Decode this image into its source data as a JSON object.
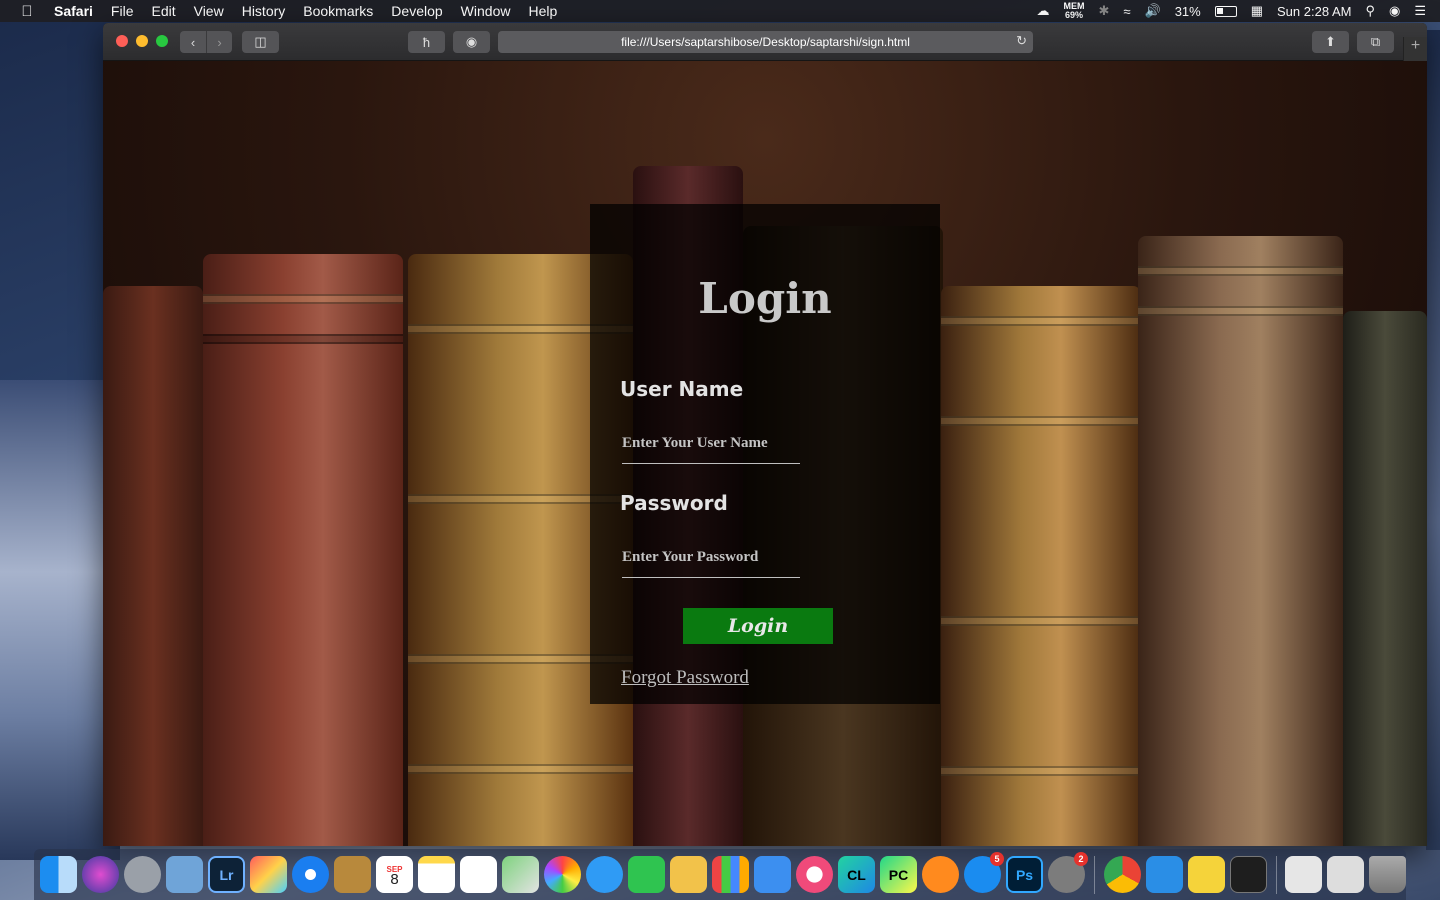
{
  "menubar": {
    "app_name": "Safari",
    "items": [
      "File",
      "Edit",
      "View",
      "History",
      "Bookmarks",
      "Develop",
      "Window",
      "Help"
    ],
    "mem_label": "MEM",
    "mem_value": "69%",
    "battery_percent": "31%",
    "battery_level": 0.31,
    "clock": "Sun 2:28 AM"
  },
  "browser": {
    "url": "file:///Users/saptarshibose/Desktop/saptarshi/sign.html"
  },
  "login": {
    "title": "Login",
    "username_label": "User Name",
    "username_placeholder": "Enter Your User Name",
    "password_label": "Password",
    "password_placeholder": "Enter Your Password",
    "button_label": "Login",
    "forgot_label": "Forgot Password"
  },
  "dock": {
    "calendar_month": "SEP",
    "calendar_day": "8",
    "lightroom_label": "Lr",
    "clion_label": "CL",
    "pycharm_label": "PC",
    "photoshop_label": "Ps",
    "appstore_badge": "5",
    "settings_badge": "2"
  }
}
